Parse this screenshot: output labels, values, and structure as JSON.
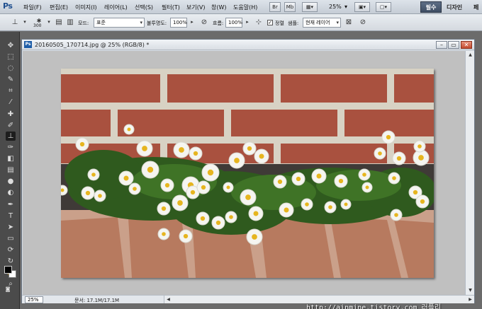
{
  "app": {
    "logo": "Ps"
  },
  "menu": [
    "파일(F)",
    "편집(E)",
    "이미지(I)",
    "레이어(L)",
    "선택(S)",
    "필터(T)",
    "보기(V)",
    "창(W)",
    "도움말(H)"
  ],
  "menu_buttons": {
    "br": "Br",
    "mb": "Mb"
  },
  "zoom_dropdown": "25%",
  "workspace": {
    "active": "필수",
    "other": "디자인",
    "more": "페"
  },
  "options": {
    "brush_size": "300",
    "mode_label": "모드:",
    "mode_value": "표준",
    "opacity_label": "불투명도:",
    "opacity_value": "100%",
    "flow_label": "흐름:",
    "flow_value": "100%",
    "aligned_label": "정렬",
    "sample_label": "샘플:",
    "sample_value": "현재 레이어",
    "aligned_checked": "✓"
  },
  "document": {
    "title": "20160505_170714.jpg @ 25% (RGB/8) *",
    "icon": "Ps",
    "watermark": "http://ainmine.tistory.com 러플리"
  },
  "status": {
    "zoom": "25%",
    "doc_info": "문서: 17.1M/17.1M"
  },
  "colors": {
    "foreground": "#000000",
    "background": "#ffffff",
    "brick": "#a9513f",
    "mortar": "#d8d2c4"
  }
}
